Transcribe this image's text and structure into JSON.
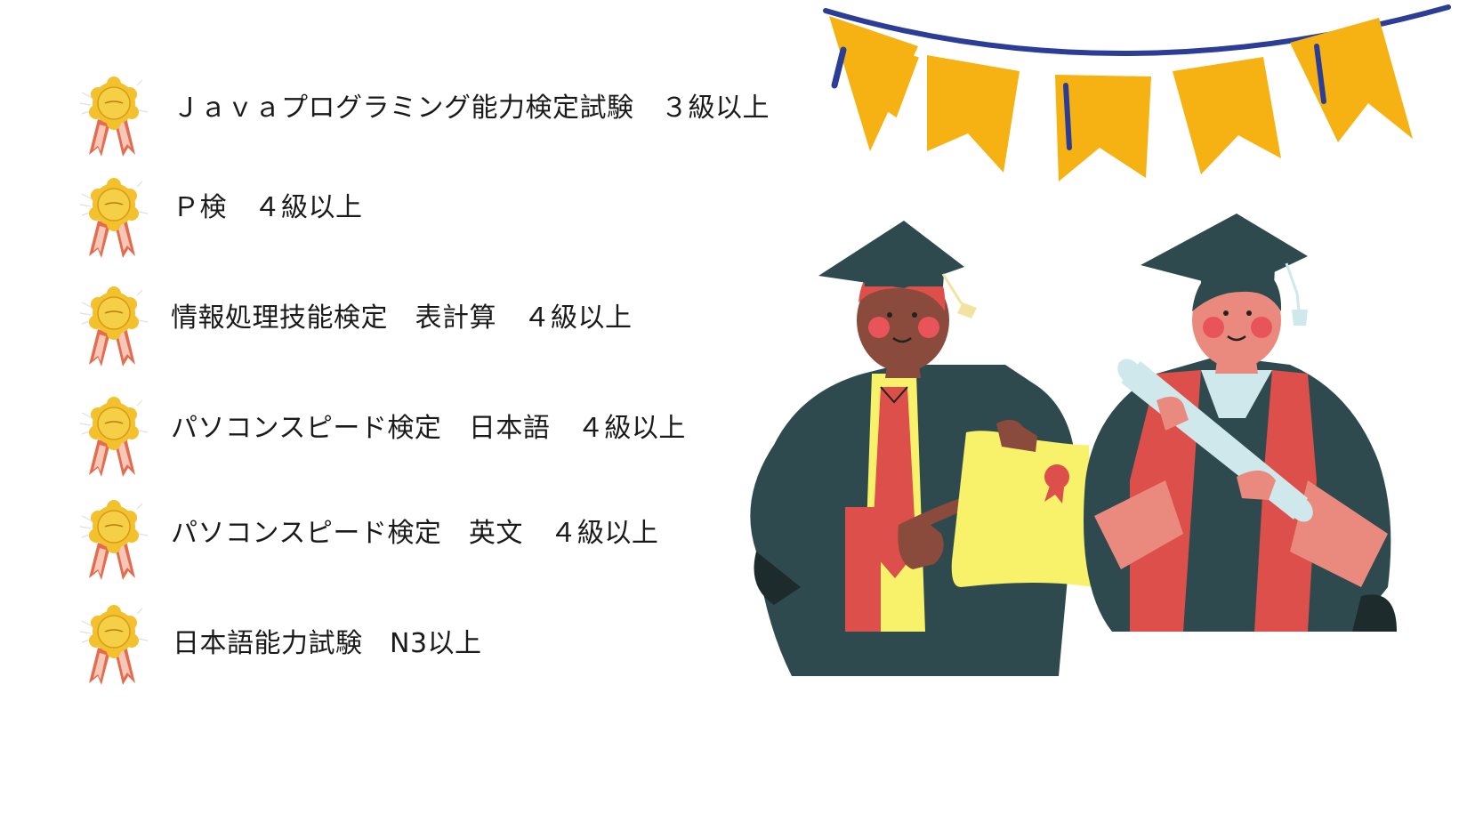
{
  "certifications": [
    {
      "label": "Ｊａｖａプログラミング能力検定試験　３級以上",
      "icon": "award-rosette-icon"
    },
    {
      "label": "Ｐ検　４級以上",
      "icon": "award-rosette-icon"
    },
    {
      "label": "情報処理技能検定　表計算　４級以上",
      "icon": "award-rosette-icon"
    },
    {
      "label": "パソコンスピード検定　日本語　４級以上",
      "icon": "award-rosette-icon"
    },
    {
      "label": "パソコンスピード検定　英文　４級以上",
      "icon": "award-rosette-icon"
    },
    {
      "label": "日本語能力試験　N3以上",
      "icon": "award-rosette-icon"
    }
  ],
  "colors": {
    "flag": "#f6b213",
    "string": "#2b3d96",
    "gown": "#2f4a4e",
    "stole": "#dc4f4a",
    "diploma": "#f8f16a",
    "scroll": "#cfe8ec"
  },
  "illustration": "graduates-celebration-illustration"
}
